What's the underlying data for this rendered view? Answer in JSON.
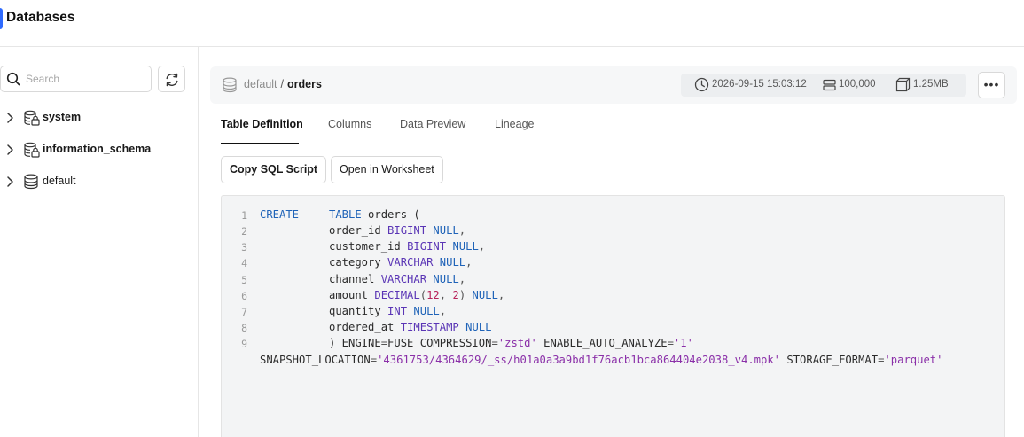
{
  "app": {
    "title": "Databases"
  },
  "sidebar": {
    "search_placeholder": "Search",
    "items": [
      {
        "label": "system",
        "bold": true,
        "icon": "database-lock-icon"
      },
      {
        "label": "information_schema",
        "bold": true,
        "icon": "database-lock-icon"
      },
      {
        "label": "default",
        "bold": false,
        "icon": "database-icon"
      }
    ]
  },
  "header": {
    "database": "default",
    "separator": "/",
    "table": "orders",
    "updated": "2026-09-15 15:03:12",
    "rows": "100,000",
    "size": "1.25MB",
    "more_label": "•••"
  },
  "tabs": [
    {
      "label": "Table Definition",
      "active": true
    },
    {
      "label": "Columns",
      "active": false
    },
    {
      "label": "Data Preview",
      "active": false
    },
    {
      "label": "Lineage",
      "active": false
    }
  ],
  "actions": {
    "copy_sql": "Copy SQL Script",
    "open_worksheet": "Open in Worksheet"
  },
  "code": {
    "line_numbers": [
      "1",
      "2",
      "3",
      "4",
      "5",
      "6",
      "7",
      "8",
      "9"
    ],
    "l1": {
      "kw1": "CREATE",
      "kw2": "TABLE",
      "rest": " orders ("
    },
    "l2": {
      "col": "order_id ",
      "type": "BIGINT",
      "null": "NULL",
      "end": ","
    },
    "l3": {
      "col": "customer_id ",
      "type": "BIGINT",
      "null": "NULL",
      "end": ","
    },
    "l4": {
      "col": "category ",
      "type": "VARCHAR",
      "null": "NULL",
      "end": ","
    },
    "l5": {
      "col": "channel ",
      "type": "VARCHAR",
      "null": "NULL",
      "end": ","
    },
    "l6": {
      "col": "amount ",
      "type": "DECIMAL",
      "p1": "(",
      "n1": "12",
      "p2": ", ",
      "n2": "2",
      "p3": ") ",
      "null": "NULL",
      "end": ","
    },
    "l7": {
      "col": "quantity ",
      "type": "INT",
      "null": "NULL",
      "end": ","
    },
    "l8": {
      "col": "ordered_at ",
      "type": "TIMESTAMP",
      "null": "NULL"
    },
    "l9": {
      "a": ") ENGINE",
      "eq1": "=",
      "b": "FUSE COMPRESSION",
      "eq2": "=",
      "s1": "'zstd'",
      "c": " ENABLE_AUTO_ANALYZE",
      "eq3": "=",
      "s2": "'1'"
    },
    "l10": {
      "a": "SNAPSHOT_LOCATION",
      "eq1": "=",
      "s1": "'4361753/4364629/_ss/h01a0a3a9bd1f76acb1bca864404e2038_v4.mpk'",
      "b": " STORAGE_FORMAT",
      "eq2": "=",
      "s2": "'parquet'"
    }
  }
}
